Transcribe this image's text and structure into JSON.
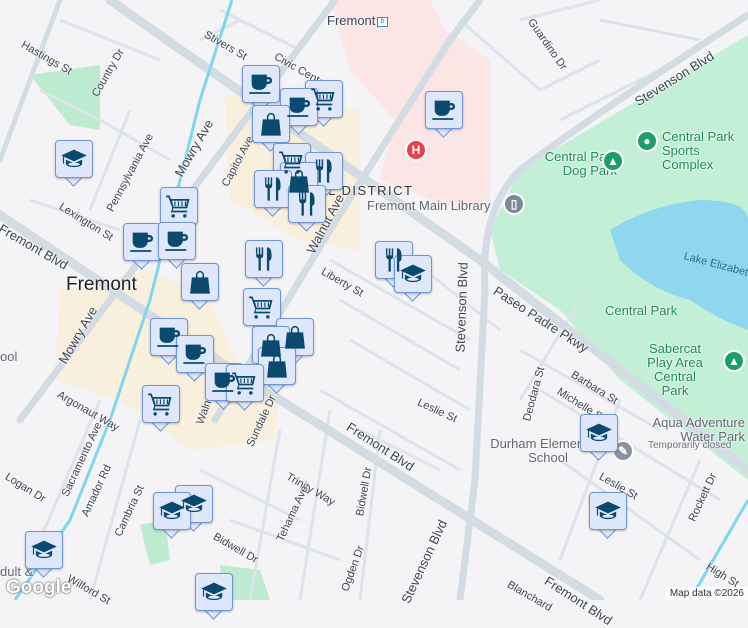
{
  "streets": {
    "hastings": "Hastings St",
    "country": "Country Dr",
    "stivers": "Stivers St",
    "civic": "Civic Center",
    "pennsylvania": "Pennsylvania Ave",
    "mowry": "Mowry Ave",
    "mowry2": "Mowry Ave",
    "capitol": "Capitol Ave",
    "lexington": "Lexington St",
    "fremont_blvd_w": "Fremont Blvd",
    "walnut": "Walnut Ave",
    "liberty": "Liberty St",
    "guardino": "Guardino Dr",
    "stevenson_ne": "Stevenson Blvd",
    "paseo": "Paseo Padre Pkwy",
    "stevenson_mid": "Stevenson Blvd",
    "stevenson_s": "Stevenson Blvd",
    "argonaut": "Argonaut Way",
    "sacramento": "Sacramento Ave",
    "logan": "Logan Dr",
    "amador": "Amador Rd",
    "cambria": "Cambria St",
    "sundale": "Sundale Dr",
    "trinity": "Trinity Way",
    "tehama": "Tehama Ave",
    "bidwell": "Bidwell Dr",
    "bidwell2": "Bidwell Dr",
    "ogden": "Ogden Dr",
    "wilford": "Wilford St",
    "fremont_blvd_s": "Fremont Blvd",
    "fremont_blvd_se": "Fremont Blvd",
    "leslie": "Leslie St",
    "leslie2": "Leslie St",
    "deodara": "Deodara St",
    "barbara": "Barbara St",
    "michelle": "Michelle St",
    "rockett": "Rockett Dr",
    "high": "High St",
    "blanchard": "Blanchard",
    "walnut2": "Walnut"
  },
  "places": {
    "city": "Fremont",
    "station": "Fremont",
    "district": "AL DISTRICT",
    "library": "Fremont Main Library",
    "dog_park": "Central Park Dog Park",
    "sports": "Central Park Sports Complex",
    "lake": "Lake Elizabeth",
    "central_park": "Central Park",
    "sabercat": "Sabercat Play Area Central Park",
    "aqua": "Aqua Adventure Water Park",
    "aqua_status": "Temporarily closed",
    "durham": "Durham Elementary School",
    "school_partial": "ool",
    "adult": "dult &"
  },
  "attribution": {
    "google": "Google",
    "map_data": "Map data ©2026"
  },
  "colors": {
    "marker_bg": "#dfe8fb",
    "marker_icon": "#0b4a6f",
    "park": "#c3efd6",
    "water": "#8fd6ef",
    "road": "#d3dbe3"
  }
}
